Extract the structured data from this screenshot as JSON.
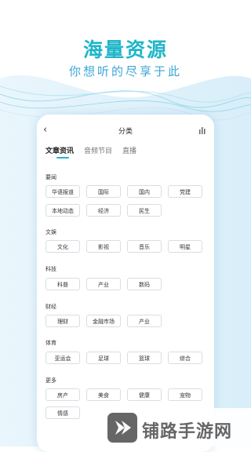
{
  "banner": {
    "headline": "海量资源",
    "subline": "你想听的尽享于此"
  },
  "app": {
    "back_icon": "chevron-left-icon",
    "title": "分类",
    "chart_icon": "bars-icon",
    "tabs": [
      {
        "label": "文章资讯",
        "active": true
      },
      {
        "label": "音频节目",
        "active": false
      },
      {
        "label": "直播",
        "active": false
      }
    ],
    "accent_color": "#29b5c6",
    "sections": [
      {
        "title": "要闻",
        "chips": [
          "华语报道",
          "国际",
          "国内",
          "党建",
          "本地动态",
          "经济",
          "民生"
        ]
      },
      {
        "title": "文娱",
        "chips": [
          "文化",
          "影视",
          "音乐",
          "明星"
        ]
      },
      {
        "title": "科技",
        "chips": [
          "科普",
          "产业",
          "数码"
        ]
      },
      {
        "title": "财经",
        "chips": [
          "理财",
          "金融市场",
          "产业"
        ]
      },
      {
        "title": "体育",
        "chips": [
          "亚运会",
          "足球",
          "篮球",
          "综合"
        ]
      },
      {
        "title": "更多",
        "chips": [
          "房产",
          "美食",
          "健康",
          "宠物",
          "情感"
        ]
      }
    ]
  },
  "watermark": {
    "text": "铺路手游网"
  }
}
